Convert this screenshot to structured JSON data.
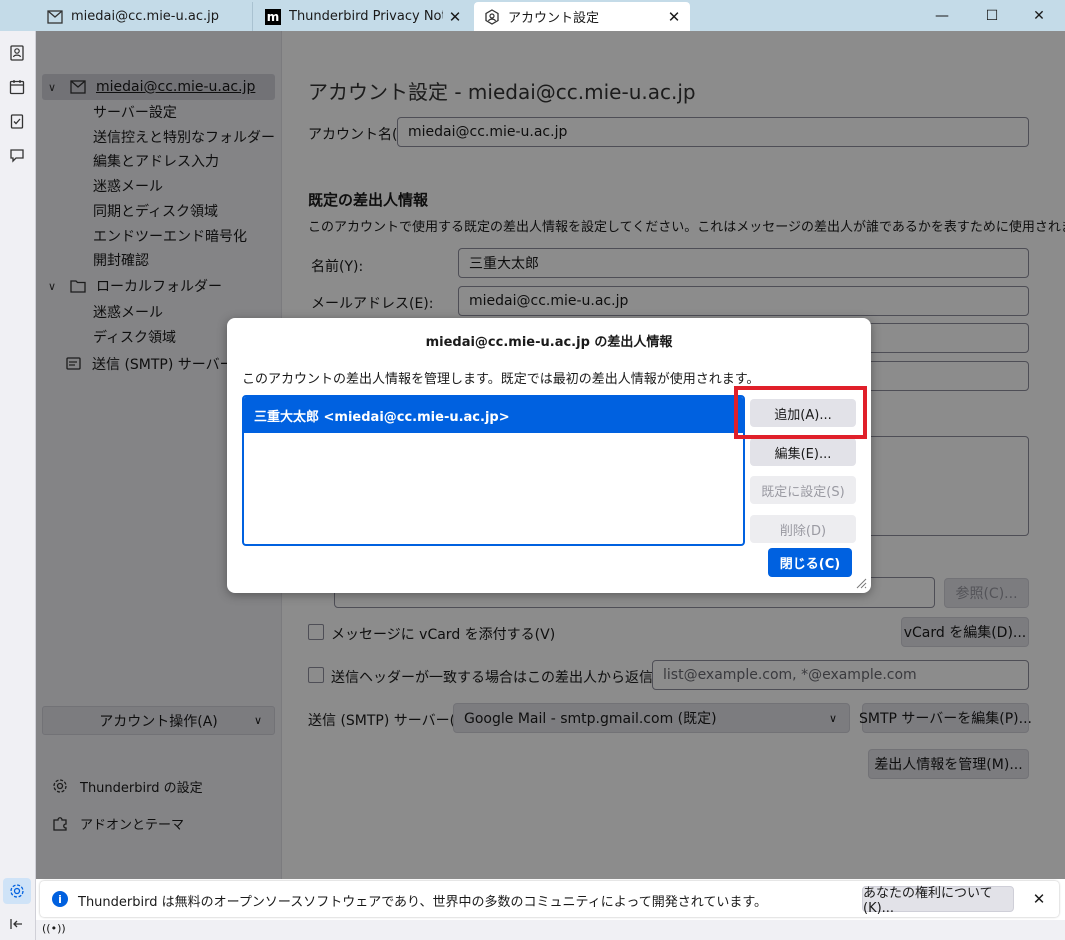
{
  "tabs": [
    {
      "label": "miedai@cc.mie-u.ac.jp",
      "icon": "mail-icon"
    },
    {
      "label": "Thunderbird Privacy Notice —",
      "icon": "mozilla-m-icon"
    },
    {
      "label": "アカウント設定",
      "icon": "account-settings-icon"
    }
  ],
  "window_controls": {
    "minimize": "—",
    "maximize": "☐",
    "close": "✕"
  },
  "tree": {
    "account": "miedai@cc.mie-u.ac.jp",
    "account_items": [
      "サーバー設定",
      "送信控えと特別なフォルダー",
      "編集とアドレス入力",
      "迷惑メール",
      "同期とディスク領域",
      "エンドツーエンド暗号化",
      "開封確認"
    ],
    "local_folders": "ローカルフォルダー",
    "local_items": [
      "迷惑メール",
      "ディスク領域"
    ],
    "smtp": "送信 (SMTP) サーバー",
    "account_actions": "アカウント操作(A)",
    "settings": "Thunderbird の設定",
    "addons": "アドオンとテーマ"
  },
  "main": {
    "page_title": "アカウント設定 - miedai@cc.mie-u.ac.jp",
    "account_name_label": "アカウント名(N):",
    "account_name_value": "miedai@cc.mie-u.ac.jp",
    "identity_heading": "既定の差出人情報",
    "identity_desc": "このアカウントで使用する既定の差出人情報を設定してください。これはメッセージの差出人が誰であるかを表すために使用されます。",
    "name_label": "名前(Y):",
    "name_value": "三重大太郎",
    "email_label": "メールアドレス(E):",
    "email_value": "miedai@cc.mie-u.ac.jp",
    "browse_button": "参照(C)...",
    "vcard_checkbox": "メッセージに vCard を添付する(V)",
    "vcard_edit_button": "vCard を編集(D)...",
    "reply_checkbox": "送信ヘッダーが一致する場合はこの差出人から返信する(D):",
    "reply_placeholder": "list@example.com, *@example.com",
    "smtp_label": "送信 (SMTP) サーバー(U):",
    "smtp_value": "Google Mail - smtp.gmail.com (既定)",
    "smtp_edit_button": "SMTP サーバーを編集(P)...",
    "manage_identities_button": "差出人情報を管理(M)..."
  },
  "dialog": {
    "title": "miedai@cc.mie-u.ac.jp の差出人情報",
    "description": "このアカウントの差出人情報を管理します。既定では最初の差出人情報が使用されます。",
    "identities": [
      "三重大太郎 <miedai@cc.mie-u.ac.jp>"
    ],
    "add_button": "追加(A)...",
    "edit_button": "編集(E)...",
    "set_default_button": "既定に設定(S)",
    "delete_button": "削除(D)",
    "close_button": "閉じる(C)",
    "highlight_color": "#e0202a",
    "accent_color": "#0061e0"
  },
  "notice": {
    "text": "Thunderbird は無料のオープンソースソフトウェアであり、世界中の多数のコミュニティによって開発されています。",
    "rights_button": "あなたの権利について(K)...",
    "close": "✕"
  },
  "statusbar": {
    "icon": "online-icon"
  }
}
